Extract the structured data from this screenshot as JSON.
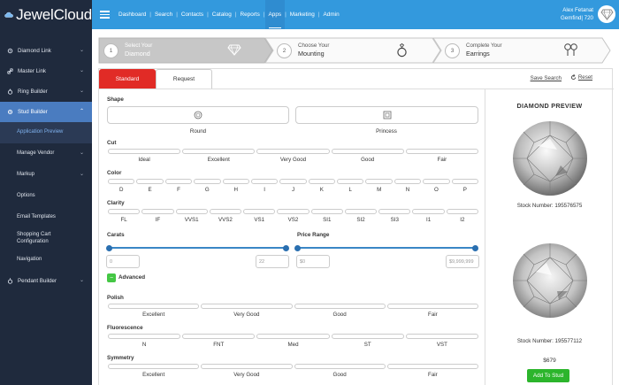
{
  "app": {
    "brand": "JewelCloud"
  },
  "sidebar": {
    "items": [
      {
        "label": "Diamond Link"
      },
      {
        "label": "Master Link"
      },
      {
        "label": "Ring Builder"
      },
      {
        "label": "Stud Builder"
      }
    ],
    "sub_items": [
      {
        "label": "Application Preview"
      },
      {
        "label": "Manage Vendor"
      },
      {
        "label": "Markup"
      },
      {
        "label": "Options"
      },
      {
        "label": "Email Templates"
      },
      {
        "label": "Shopping Cart Configuration"
      },
      {
        "label": "Navigation"
      }
    ],
    "pendant": {
      "label": "Pendant Builder"
    }
  },
  "topnav": {
    "items": [
      "Dashboard",
      "Search",
      "Contacts",
      "Catalog",
      "Reports",
      "Apps",
      "Marketing",
      "Admin"
    ],
    "active": "Apps",
    "user_name": "Alex Fetanat",
    "user_org": "Gemfind| 720"
  },
  "steps": [
    {
      "num": "1",
      "line1": "Select Your",
      "line2": "Diamond"
    },
    {
      "num": "2",
      "line1": "Choose Your",
      "line2": "Mounting"
    },
    {
      "num": "3",
      "line1": "Complete Your",
      "line2": "Earrings"
    }
  ],
  "tabs": {
    "standard": "Standard",
    "request": "Request"
  },
  "actions": {
    "save_search": "Save Search",
    "reset": "Reset"
  },
  "filters": {
    "shape_label": "Shape",
    "shapes": [
      "Round",
      "Princess"
    ],
    "cut_label": "Cut",
    "cut": [
      "Ideal",
      "Excellent",
      "Very Good",
      "Good",
      "Fair"
    ],
    "color_label": "Color",
    "color": [
      "D",
      "E",
      "F",
      "G",
      "H",
      "I",
      "J",
      "K",
      "L",
      "M",
      "N",
      "O",
      "P"
    ],
    "clarity_label": "Clarity",
    "clarity": [
      "FL",
      "IF",
      "VVS1",
      "VVS2",
      "VS1",
      "VS2",
      "SI1",
      "SI2",
      "SI3",
      "I1",
      "I2"
    ],
    "carats_label": "Carats",
    "carat_min": "0",
    "carat_max": "22",
    "price_label": "Price Range",
    "price_min": "$0",
    "price_max": "$9,999,999",
    "advanced_label": "Advanced",
    "advanced_icon": "minus",
    "polish_label": "Polish",
    "polish": [
      "Excellent",
      "Very Good",
      "Good",
      "Fair"
    ],
    "fluorescence_label": "Fluorescence",
    "fluorescence": [
      "N",
      "FNT",
      "Med",
      "ST",
      "VST"
    ],
    "symmetry_label": "Symmetry",
    "symmetry": [
      "Excellent",
      "Very Good",
      "Good",
      "Fair"
    ]
  },
  "preview": {
    "title": "DIAMOND PREVIEW",
    "stock1": "Stock Number: 195576575",
    "stock2": "Stock Number: 195577112",
    "price": "$679",
    "add_button": "Add To Stud"
  },
  "colors": {
    "sidebar": "#1f2a3d",
    "topbar": "#3399dd",
    "active_tab": "#e12b26",
    "slider": "#3a86c6",
    "add_button": "#2cb52c"
  }
}
